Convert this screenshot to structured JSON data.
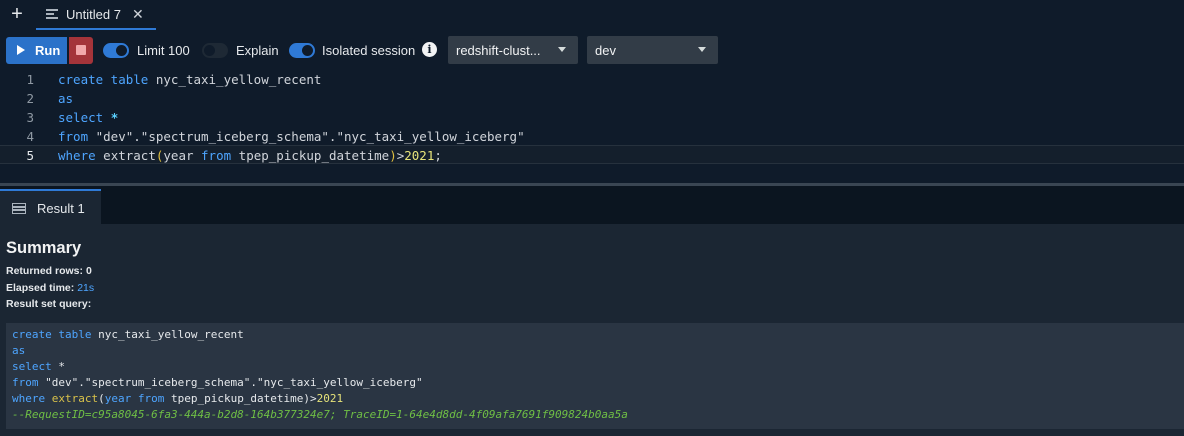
{
  "tabs": [
    {
      "label": "Untitled 7"
    }
  ],
  "toolbar": {
    "run_label": "Run",
    "limit_label": "Limit 100",
    "limit_on": true,
    "explain_label": "Explain",
    "explain_on": false,
    "isolated_label": "Isolated session",
    "isolated_on": true,
    "cluster_value": "redshift-clust...",
    "database_value": "dev"
  },
  "editor": {
    "active_line": 5,
    "lines": [
      {
        "n": "1",
        "text": "create table nyc_taxi_yellow_recent"
      },
      {
        "n": "2",
        "text": "as"
      },
      {
        "n": "3",
        "text": "select *"
      },
      {
        "n": "4",
        "text": "from \"dev\".\"spectrum_iceberg_schema\".\"nyc_taxi_yellow_iceberg\""
      },
      {
        "n": "5",
        "text": "where extract(year from tpep_pickup_datetime)>2021;"
      }
    ]
  },
  "results": {
    "tab_label": "Result 1",
    "summary_title": "Summary",
    "returned_rows_label": "Returned rows:",
    "returned_rows_value": "0",
    "elapsed_label": "Elapsed time:",
    "elapsed_value": "21s",
    "query_label": "Result set query:",
    "query_lines": [
      "create table nyc_taxi_yellow_recent",
      "as",
      "select *",
      "from \"dev\".\"spectrum_iceberg_schema\".\"nyc_taxi_yellow_iceberg\"",
      "where extract(year from tpep_pickup_datetime)>2021",
      "--RequestID=c95a8045-6fa3-444a-b2d8-164b377324e7; TraceID=1-64e4d8dd-4f09afa7691f909824b0aa5a"
    ]
  },
  "colors": {
    "accent": "#2f7ad6",
    "stop": "#a4343a",
    "keyword": "#4ea5ff",
    "comment": "#6fbf45"
  }
}
